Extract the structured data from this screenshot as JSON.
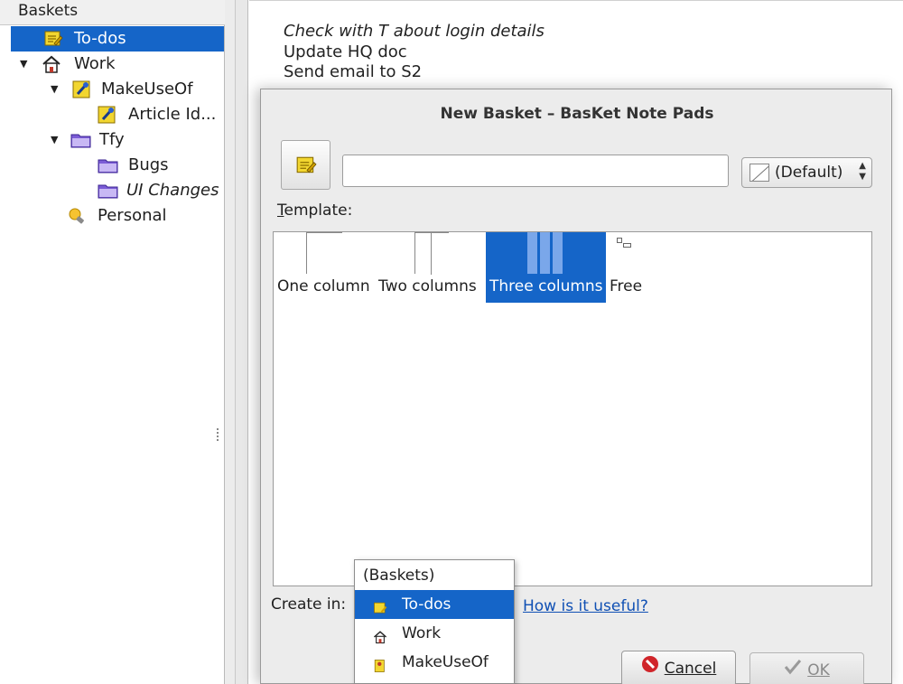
{
  "tree": {
    "header": "Baskets",
    "items": [
      {
        "label": "To-dos",
        "icon": "notepad-icon",
        "selected": true
      },
      {
        "label": "Work",
        "icon": "home-icon",
        "expanded": true
      },
      {
        "label": "MakeUseOf",
        "icon": "pin-note-icon",
        "expanded": true
      },
      {
        "label": "Article Id...",
        "icon": "pin-note-icon"
      },
      {
        "label": "Tfy",
        "icon": "folder-icon",
        "expanded": true
      },
      {
        "label": "Bugs",
        "icon": "folder-icon"
      },
      {
        "label": "UI Changes",
        "icon": "folder-icon"
      },
      {
        "label": "Personal",
        "icon": "lightbulb-icon"
      }
    ]
  },
  "notes": [
    "Check with T about login details",
    "Update HQ doc",
    "Send email to S2"
  ],
  "dialog": {
    "title": "New Basket – BasKet Note Pads",
    "name_value": "",
    "color_value": "(Default)",
    "template_label_first": "T",
    "template_label_rest": "emplate:",
    "templates": [
      {
        "name": "One column",
        "selected": false
      },
      {
        "name": "Two columns",
        "selected": false
      },
      {
        "name": "Three columns",
        "selected": true
      },
      {
        "name": "Free",
        "selected": false
      }
    ],
    "create_in_label": "Create in:",
    "help_link": "How is it useful?",
    "cancel_label": "Cancel",
    "ok_label": "OK"
  },
  "dropdown": {
    "items": [
      {
        "label": "(Baskets)",
        "icon": ""
      },
      {
        "label": "To-dos",
        "icon": "notepad-icon",
        "selected": true
      },
      {
        "label": "Work",
        "icon": "home-icon"
      },
      {
        "label": "MakeUseOf",
        "icon": "pin-note-icon"
      }
    ]
  },
  "colors": {
    "selection": "#1565c8",
    "link": "#1050b4",
    "folder": "#7b5cd6",
    "note_yellow": "#f2d630"
  }
}
